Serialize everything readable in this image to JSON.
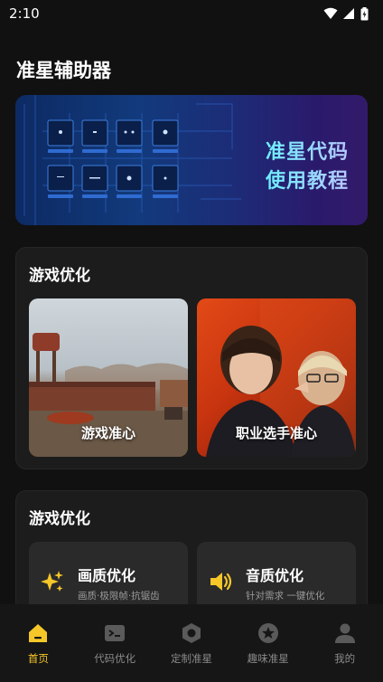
{
  "status": {
    "time": "2:10"
  },
  "app": {
    "title": "准星辅助器"
  },
  "banner": {
    "line1": "准星代码",
    "line2": "使用教程"
  },
  "sections": [
    {
      "title": "游戏优化",
      "tiles": [
        {
          "label": "游戏准心"
        },
        {
          "label": "职业选手准心"
        }
      ]
    },
    {
      "title": "游戏优化",
      "features": [
        {
          "name": "画质优化",
          "sub": "画质·极限帧·抗锯齿",
          "icon": "sparkle-icon",
          "icon_color": "#f6c728"
        },
        {
          "name": "音质优化",
          "sub": "针对需求 一键优化",
          "icon": "speaker-icon",
          "icon_color": "#f6c728"
        }
      ]
    }
  ],
  "tabs": [
    {
      "label": "首页",
      "icon": "home-icon",
      "active": true
    },
    {
      "label": "代码优化",
      "icon": "terminal-icon",
      "active": false
    },
    {
      "label": "定制准星",
      "icon": "hexagon-icon",
      "active": false
    },
    {
      "label": "趣味准星",
      "icon": "star-icon",
      "active": false
    },
    {
      "label": "我的",
      "icon": "user-icon",
      "active": false
    }
  ],
  "colors": {
    "accent": "#f6c728",
    "background": "#111111",
    "card": "#1c1c1c"
  }
}
